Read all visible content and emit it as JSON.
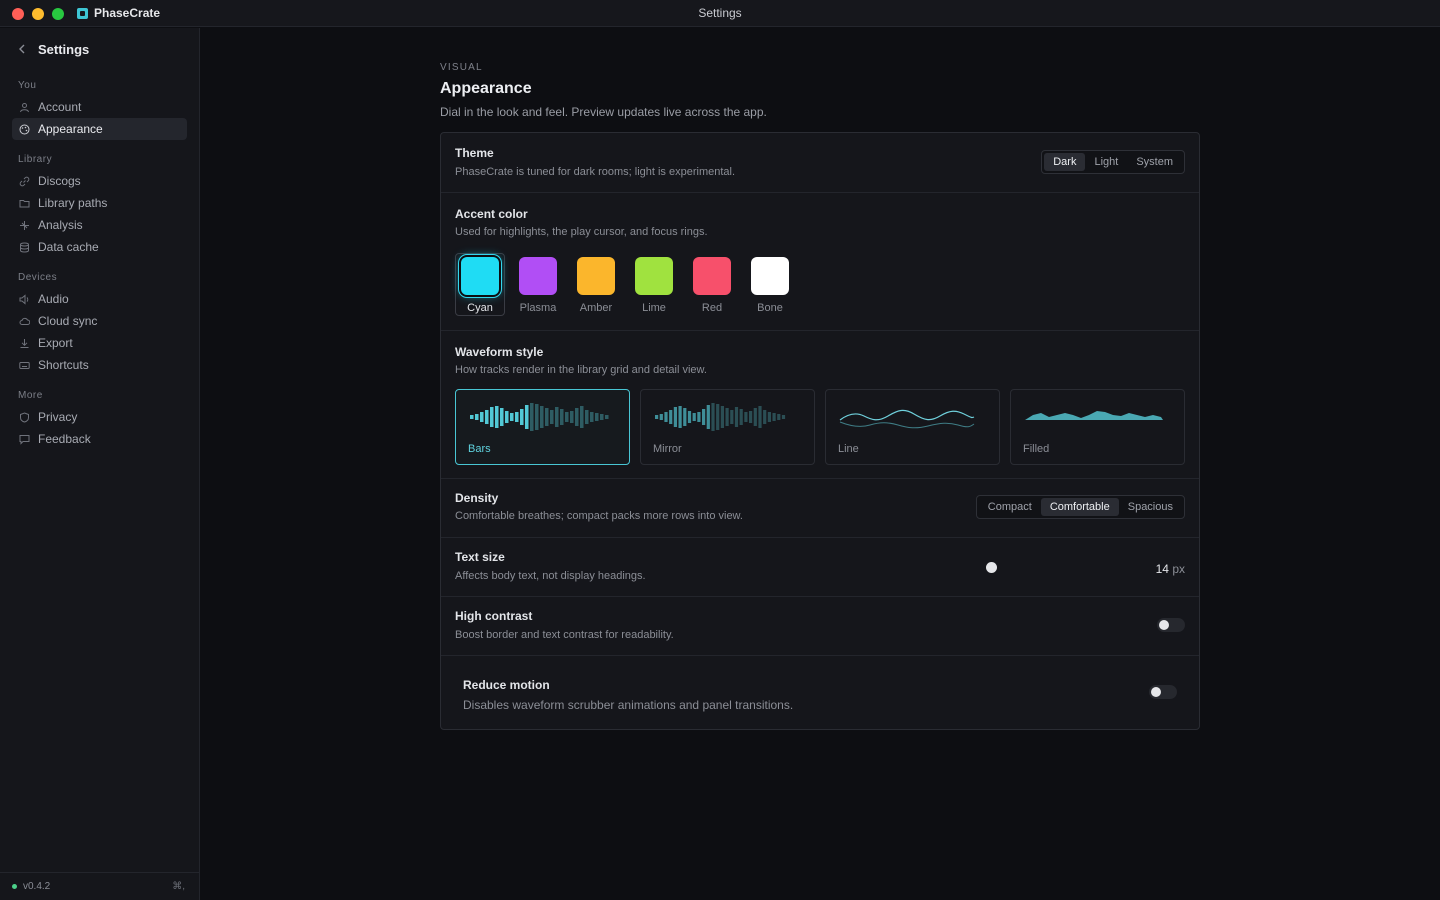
{
  "titlebar": {
    "app_name": "PhaseCrate",
    "window_title": "Settings"
  },
  "sidebar": {
    "back_icon": "chevron-left-icon",
    "title": "Settings",
    "groups": [
      {
        "label": "You",
        "items": [
          {
            "label": "Account",
            "icon": "user-icon"
          },
          {
            "label": "Appearance",
            "icon": "palette-icon",
            "active": true
          }
        ]
      },
      {
        "label": "Library",
        "items": [
          {
            "label": "Discogs",
            "icon": "link-icon"
          },
          {
            "label": "Library paths",
            "icon": "folder-icon"
          },
          {
            "label": "Analysis",
            "icon": "sparkle-icon"
          },
          {
            "label": "Data cache",
            "icon": "database-icon"
          }
        ]
      },
      {
        "label": "Devices",
        "items": [
          {
            "label": "Audio",
            "icon": "speaker-icon"
          },
          {
            "label": "Cloud sync",
            "icon": "cloud-icon"
          },
          {
            "label": "Export",
            "icon": "download-icon"
          },
          {
            "label": "Shortcuts",
            "icon": "keyboard-icon"
          }
        ]
      },
      {
        "label": "More",
        "items": [
          {
            "label": "Privacy",
            "icon": "shield-icon"
          },
          {
            "label": "Feedback",
            "icon": "message-icon"
          }
        ]
      }
    ],
    "version": "v0.4.2",
    "shortcut_hint": "⌘,"
  },
  "page": {
    "eyebrow": "VISUAL",
    "title": "Appearance",
    "description": "Dial in the look and feel. Preview updates live across the app."
  },
  "theme": {
    "title": "Theme",
    "description": "PhaseCrate is tuned for dark rooms; light is experimental.",
    "options": [
      "Dark",
      "Light",
      "System"
    ],
    "selected": "Dark"
  },
  "accent": {
    "title": "Accent color",
    "description": "Used for highlights, the play cursor, and focus rings.",
    "swatches": [
      {
        "name": "Cyan",
        "color": "#1fdcf4"
      },
      {
        "name": "Plasma",
        "color": "#b14ef5"
      },
      {
        "name": "Amber",
        "color": "#fbb62c"
      },
      {
        "name": "Lime",
        "color": "#a0e23f"
      },
      {
        "name": "Red",
        "color": "#f7506b"
      },
      {
        "name": "Bone",
        "color": "#ffffff"
      }
    ],
    "selected": "Cyan"
  },
  "waveform": {
    "title": "Waveform style",
    "description": "How tracks render in the library grid and detail view.",
    "styles": [
      "Bars",
      "Mirror",
      "Line",
      "Filled"
    ],
    "selected": "Bars"
  },
  "density": {
    "title": "Density",
    "description": "Comfortable breathes; compact packs more rows into view.",
    "options": [
      "Compact",
      "Comfortable",
      "Spacious"
    ],
    "selected": "Comfortable"
  },
  "text_size": {
    "title": "Text size",
    "description": "Affects body text, not display headings.",
    "value": "14",
    "unit": "px"
  },
  "high_contrast": {
    "title": "High contrast",
    "description": "Boost border and text contrast for readability.",
    "enabled": false
  },
  "reduce_motion": {
    "title": "Reduce motion",
    "description": "Disables waveform scrubber animations and panel transitions.",
    "enabled": false
  }
}
